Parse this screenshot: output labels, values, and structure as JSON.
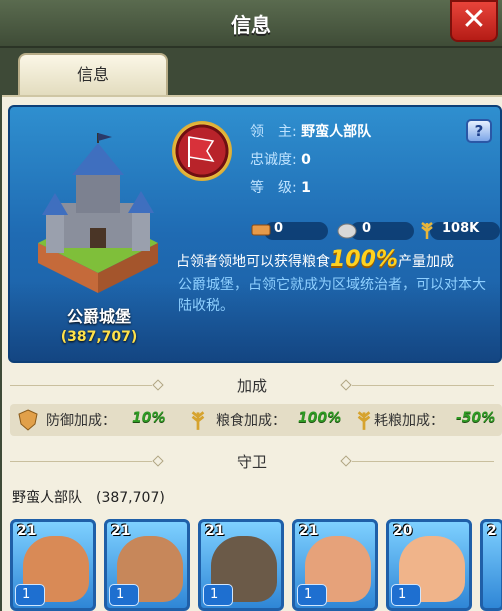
{
  "header": {
    "title": "信息",
    "close_icon": "close-icon"
  },
  "tabs": [
    {
      "label": "信息"
    }
  ],
  "castle": {
    "name": "公爵城堡",
    "power": "(387,707)"
  },
  "lord": {
    "lord_label": "领　主:",
    "lord_value": "野蛮人部队",
    "loyalty_label": "忠诚度:",
    "loyalty_value": "0",
    "level_label": "等　级:",
    "level_value": "1"
  },
  "resources": [
    {
      "icon": "brick-icon",
      "value": "0"
    },
    {
      "icon": "stone-icon",
      "value": "0"
    },
    {
      "icon": "wheat-icon",
      "value": "108K"
    }
  ],
  "bonus_line": {
    "prefix": "占领者领地可以获得粮食",
    "big": "100%",
    "suffix": "产量加成"
  },
  "description": "公爵城堡，占领它就成为区域统治者，可以对本大陆收税。",
  "sections": {
    "bonus": "加成",
    "guard": "守卫"
  },
  "bonuses": [
    {
      "icon": "shield-icon",
      "label": "防御加成：",
      "value": "10%"
    },
    {
      "icon": "wheat-icon",
      "label": "粮食加成：",
      "value": "100%"
    },
    {
      "icon": "wheat-icon",
      "label": "耗粮加成：",
      "value": "-50%"
    }
  ],
  "guard": {
    "title": "野蛮人部队　(387,707)"
  },
  "troops": [
    {
      "level": "21",
      "count": "1",
      "color": "#d98a56"
    },
    {
      "level": "21",
      "count": "1",
      "color": "#c7875a"
    },
    {
      "level": "21",
      "count": "1",
      "color": "#6b5a48"
    },
    {
      "level": "21",
      "count": "1",
      "color": "#e6a27a"
    },
    {
      "level": "20",
      "count": "1",
      "color": "#f0b48a"
    },
    {
      "level": "2",
      "count": "",
      "color": "#7ed0ff"
    }
  ],
  "colors": {
    "accent": "#ffd21f",
    "positive": "#2f9b24",
    "card_bg": "#1f6bb3"
  }
}
